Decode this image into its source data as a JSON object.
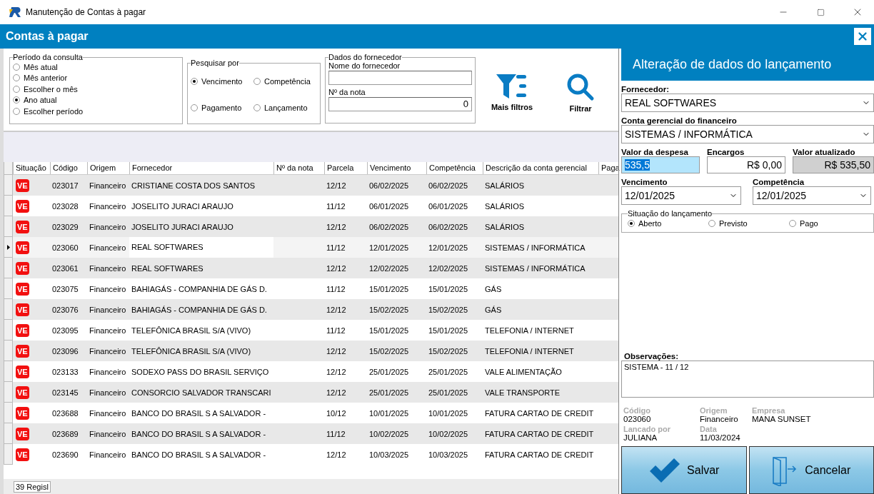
{
  "window": {
    "title": "Manutenção de Contas à pagar"
  },
  "header": {
    "title": "Contas à pagar"
  },
  "periodo": {
    "legend": "Período da consulta",
    "options": [
      {
        "label": "Mês atual",
        "selected": false
      },
      {
        "label": "Mês anterior",
        "selected": false
      },
      {
        "label": "Escolher o mês",
        "selected": false
      },
      {
        "label": "Ano atual",
        "selected": true
      },
      {
        "label": "Escolher período",
        "selected": false
      }
    ]
  },
  "pesquisar": {
    "legend": "Pesquisar por",
    "options": [
      {
        "label": "Vencimento",
        "selected": true
      },
      {
        "label": "Competência",
        "selected": false
      },
      {
        "label": "Pagamento",
        "selected": false
      },
      {
        "label": "Lançamento",
        "selected": false
      }
    ]
  },
  "fornecedor_box": {
    "legend": "Dados do fornecedor",
    "name_label": "Nome do fornecedor",
    "nota_label": "Nº da nota",
    "nota_value": "0"
  },
  "actions": [
    {
      "kind": "filter",
      "label": "Mais filtros"
    },
    {
      "kind": "search",
      "label": "Filtrar"
    }
  ],
  "table": {
    "columns": [
      "Situação",
      "Código",
      "Origem",
      "Fornecedor",
      "Nº da nota",
      "Parcela",
      "Vencimento",
      "Competência",
      "Descrição da conta gerencial",
      "Paga"
    ],
    "rows": [
      {
        "status": "VE",
        "codigo": "023017",
        "origem": "Financeiro",
        "fornecedor": "CRISTIANE COSTA DOS SANTOS",
        "parcela": "12/12",
        "vencimento": "06/02/2025",
        "competencia": "06/02/2025",
        "descricao": "SALÁRIOS",
        "selected": false
      },
      {
        "status": "VE",
        "codigo": "023028",
        "origem": "Financeiro",
        "fornecedor": "JOSELITO JURACI ARAUJO",
        "parcela": "11/12",
        "vencimento": "06/01/2025",
        "competencia": "06/01/2025",
        "descricao": "SALÁRIOS",
        "selected": false
      },
      {
        "status": "VE",
        "codigo": "023029",
        "origem": "Financeiro",
        "fornecedor": "JOSELITO JURACI ARAUJO",
        "parcela": "12/12",
        "vencimento": "06/02/2025",
        "competencia": "06/02/2025",
        "descricao": "SALÁRIOS",
        "selected": false
      },
      {
        "status": "VE",
        "codigo": "023060",
        "origem": "Financeiro",
        "fornecedor": "REAL SOFTWARES",
        "parcela": "11/12",
        "vencimento": "12/01/2025",
        "competencia": "12/01/2025",
        "descricao": "SISTEMAS / INFORMÁTICA",
        "selected": true
      },
      {
        "status": "VE",
        "codigo": "023061",
        "origem": "Financeiro",
        "fornecedor": "REAL SOFTWARES",
        "parcela": "12/12",
        "vencimento": "12/02/2025",
        "competencia": "12/02/2025",
        "descricao": "SISTEMAS / INFORMÁTICA",
        "selected": false
      },
      {
        "status": "VE",
        "codigo": "023075",
        "origem": "Financeiro",
        "fornecedor": "BAHIAGÁS - COMPANHIA DE GÁS D.",
        "parcela": "11/12",
        "vencimento": "15/01/2025",
        "competencia": "15/01/2025",
        "descricao": "GÁS",
        "selected": false
      },
      {
        "status": "VE",
        "codigo": "023076",
        "origem": "Financeiro",
        "fornecedor": "BAHIAGÁS - COMPANHIA DE GÁS D.",
        "parcela": "12/12",
        "vencimento": "15/02/2025",
        "competencia": "15/02/2025",
        "descricao": "GÁS",
        "selected": false
      },
      {
        "status": "VE",
        "codigo": "023095",
        "origem": "Financeiro",
        "fornecedor": "TELEFÔNICA BRASIL S/A (VIVO)",
        "parcela": "11/12",
        "vencimento": "15/01/2025",
        "competencia": "15/01/2025",
        "descricao": "TELEFONIA / INTERNET",
        "selected": false
      },
      {
        "status": "VE",
        "codigo": "023096",
        "origem": "Financeiro",
        "fornecedor": "TELEFÔNICA BRASIL S/A (VIVO)",
        "parcela": "12/12",
        "vencimento": "15/02/2025",
        "competencia": "15/02/2025",
        "descricao": "TELEFONIA / INTERNET",
        "selected": false
      },
      {
        "status": "VE",
        "codigo": "023133",
        "origem": "Financeiro",
        "fornecedor": "SODEXO PASS DO BRASIL SERVIÇO",
        "parcela": "12/12",
        "vencimento": "25/01/2025",
        "competencia": "25/01/2025",
        "descricao": "VALE ALIMENTAÇÃO",
        "selected": false
      },
      {
        "status": "VE",
        "codigo": "023145",
        "origem": "Financeiro",
        "fornecedor": "CONSORCIO SALVADOR TRANSCARI",
        "parcela": "12/12",
        "vencimento": "25/01/2025",
        "competencia": "25/01/2025",
        "descricao": "VALE TRANSPORTE",
        "selected": false
      },
      {
        "status": "VE",
        "codigo": "023688",
        "origem": "Financeiro",
        "fornecedor": "BANCO DO BRASIL S A SALVADOR -",
        "parcela": "10/12",
        "vencimento": "10/01/2025",
        "competencia": "10/01/2025",
        "descricao": "FATURA CARTAO DE CREDIT",
        "selected": false
      },
      {
        "status": "VE",
        "codigo": "023689",
        "origem": "Financeiro",
        "fornecedor": "BANCO DO BRASIL S A SALVADOR -",
        "parcela": "11/12",
        "vencimento": "10/02/2025",
        "competencia": "10/02/2025",
        "descricao": "FATURA CARTAO DE CREDIT",
        "selected": false
      },
      {
        "status": "VE",
        "codigo": "023690",
        "origem": "Financeiro",
        "fornecedor": "BANCO DO BRASIL S A SALVADOR -",
        "parcela": "12/12",
        "vencimento": "10/03/2025",
        "competencia": "10/03/2025",
        "descricao": "FATURA CARTAO DE CREDIT",
        "selected": false
      }
    ]
  },
  "status_bar": {
    "count": "39 Regisl"
  },
  "edit_panel": {
    "title": "Alteração de dados do lançamento",
    "fornecedor_label": "Fornecedor:",
    "fornecedor_value": "REAL SOFTWARES",
    "conta_label": "Conta gerencial do financeiro",
    "conta_value": "SISTEMAS / INFORMÁTICA",
    "valor_label": "Valor da despesa",
    "valor_value": "535,5",
    "encargos_label": "Encargos",
    "encargos_value": "R$ 0,00",
    "atualizado_label": "Valor atualizado",
    "atualizado_value": "R$ 535,50",
    "vencimento_label": "Vencimento",
    "vencimento_value": "12/01/2025",
    "competencia_label": "Competência",
    "competencia_value": "12/01/2025",
    "situacao": {
      "legend": "Situação do lançamento",
      "options": [
        {
          "label": "Aberto",
          "selected": true
        },
        {
          "label": "Previsto",
          "selected": false
        },
        {
          "label": "Pago",
          "selected": false
        }
      ]
    },
    "obs_label": "Observações:",
    "obs_value": "SISTEMA - 11 / 12",
    "info": [
      {
        "label": "Código",
        "value": "023060"
      },
      {
        "label": "Origem",
        "value": "Financeiro"
      },
      {
        "label": "Empresa",
        "value": "MANA SUNSET"
      },
      {
        "label": "Lancado por",
        "value": "JULIANA"
      },
      {
        "label": "Data",
        "value": "11/03/2024"
      }
    ],
    "buttons": [
      {
        "kind": "save",
        "label": "Salvar"
      },
      {
        "kind": "cancel",
        "label": "Cancelar"
      }
    ]
  }
}
